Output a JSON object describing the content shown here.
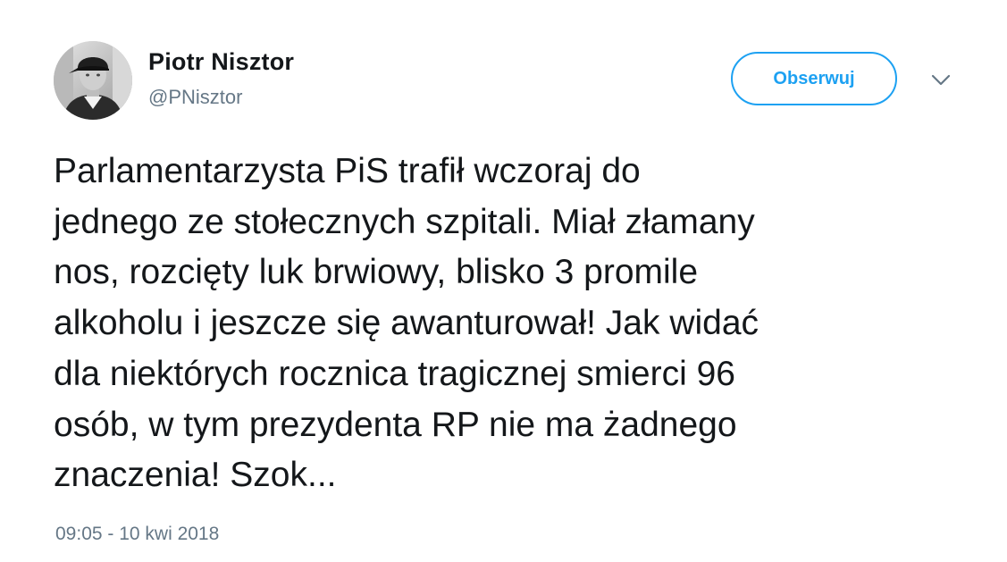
{
  "author": {
    "name": "Piotr Nisztor",
    "handle": "@PNisztor"
  },
  "follow_button": {
    "label": "Obserwuj"
  },
  "menu": {
    "icon": "chevron-down-icon"
  },
  "tweet": {
    "lines": [
      "Parlamentarzysta PiS trafił wczoraj do",
      "jednego ze stołecznych szpitali. Miał złamany",
      "nos, rozcięty luk brwiowy, blisko 3 promile",
      "alkoholu i jeszcze się awanturował! Jak widać",
      "dla niektórych rocznica tragicznej smierci 96",
      "osób, w tym prezydenta RP nie ma żadnego",
      "znaczenia! Szok..."
    ]
  },
  "timestamp": "09:05 - 10 kwi 2018",
  "colors": {
    "accent": "#1da1f2",
    "text": "#14171a",
    "muted": "#657786"
  }
}
